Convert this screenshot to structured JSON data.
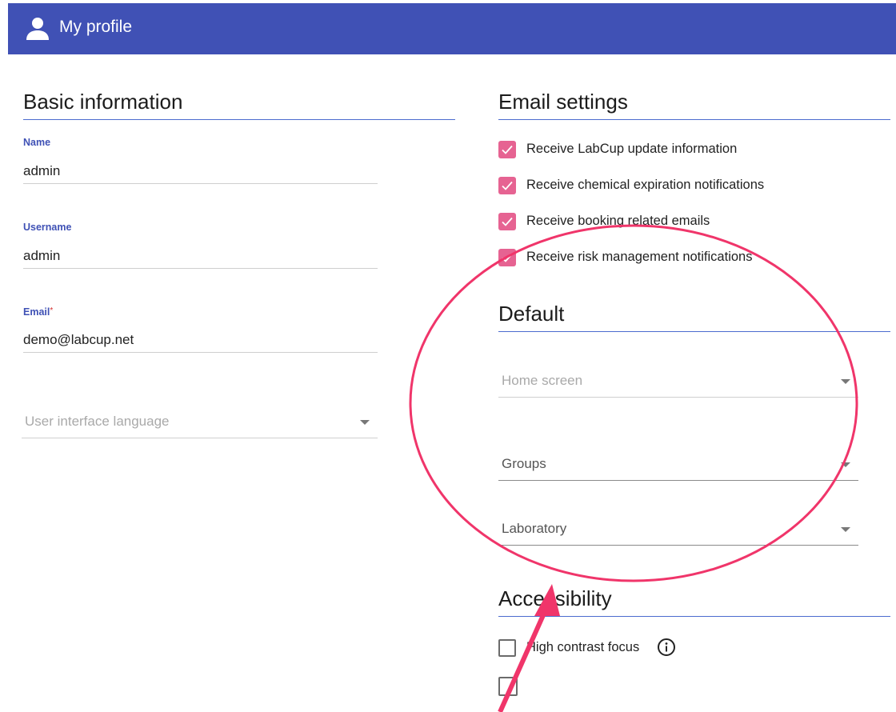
{
  "header": {
    "title": "My profile",
    "icon": "person-icon"
  },
  "basic_info": {
    "title": "Basic information",
    "name": {
      "label": "Name",
      "value": "admin"
    },
    "username": {
      "label": "Username",
      "value": "admin"
    },
    "email": {
      "label": "Email",
      "required_mark": "*",
      "value": "demo@labcup.net"
    },
    "language": {
      "placeholder": "User interface language"
    }
  },
  "email_settings": {
    "title": "Email settings",
    "items": [
      {
        "label": "Receive LabCup update information",
        "checked": true
      },
      {
        "label": "Receive chemical expiration notifications",
        "checked": true
      },
      {
        "label": "Receive booking related emails",
        "checked": true
      },
      {
        "label": "Receive risk management notifications",
        "checked": true
      }
    ]
  },
  "default": {
    "title": "Default",
    "home_screen": {
      "placeholder": "Home screen"
    },
    "groups": {
      "label": "Groups"
    },
    "laboratory": {
      "label": "Laboratory"
    }
  },
  "accessibility": {
    "title": "Accessibility",
    "items": [
      {
        "label": "High contrast focus",
        "checked": false,
        "icon": "info-icon"
      }
    ]
  },
  "colors": {
    "header": "#4051b5",
    "accent": "#3f51b5",
    "checkbox": "#e66392",
    "annotation": "#f0356a"
  }
}
